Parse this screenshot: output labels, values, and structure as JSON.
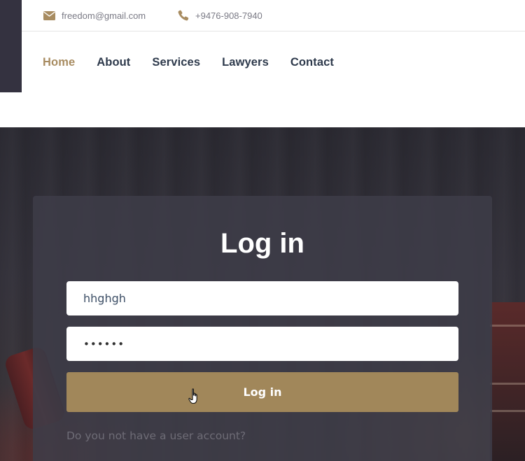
{
  "header": {
    "email": "freedom@gmail.com",
    "phone": "+9476-908-7940",
    "icons": {
      "email": "envelope-icon",
      "phone": "phone-icon"
    }
  },
  "nav": {
    "items": [
      {
        "label": "Home",
        "active": true
      },
      {
        "label": "About",
        "active": false
      },
      {
        "label": "Services",
        "active": false
      },
      {
        "label": "Lawyers",
        "active": false
      },
      {
        "label": "Contact",
        "active": false
      }
    ]
  },
  "login": {
    "title": "Log in",
    "username_value": "hhghgh",
    "password_value": "••••••",
    "button_label": "Log in",
    "signup_prompt": "Do you not have a user account?"
  },
  "colors": {
    "accent": "#a88c61",
    "button": "#a1875a",
    "nav_text": "#2e3a4c",
    "dark": "#343240"
  }
}
